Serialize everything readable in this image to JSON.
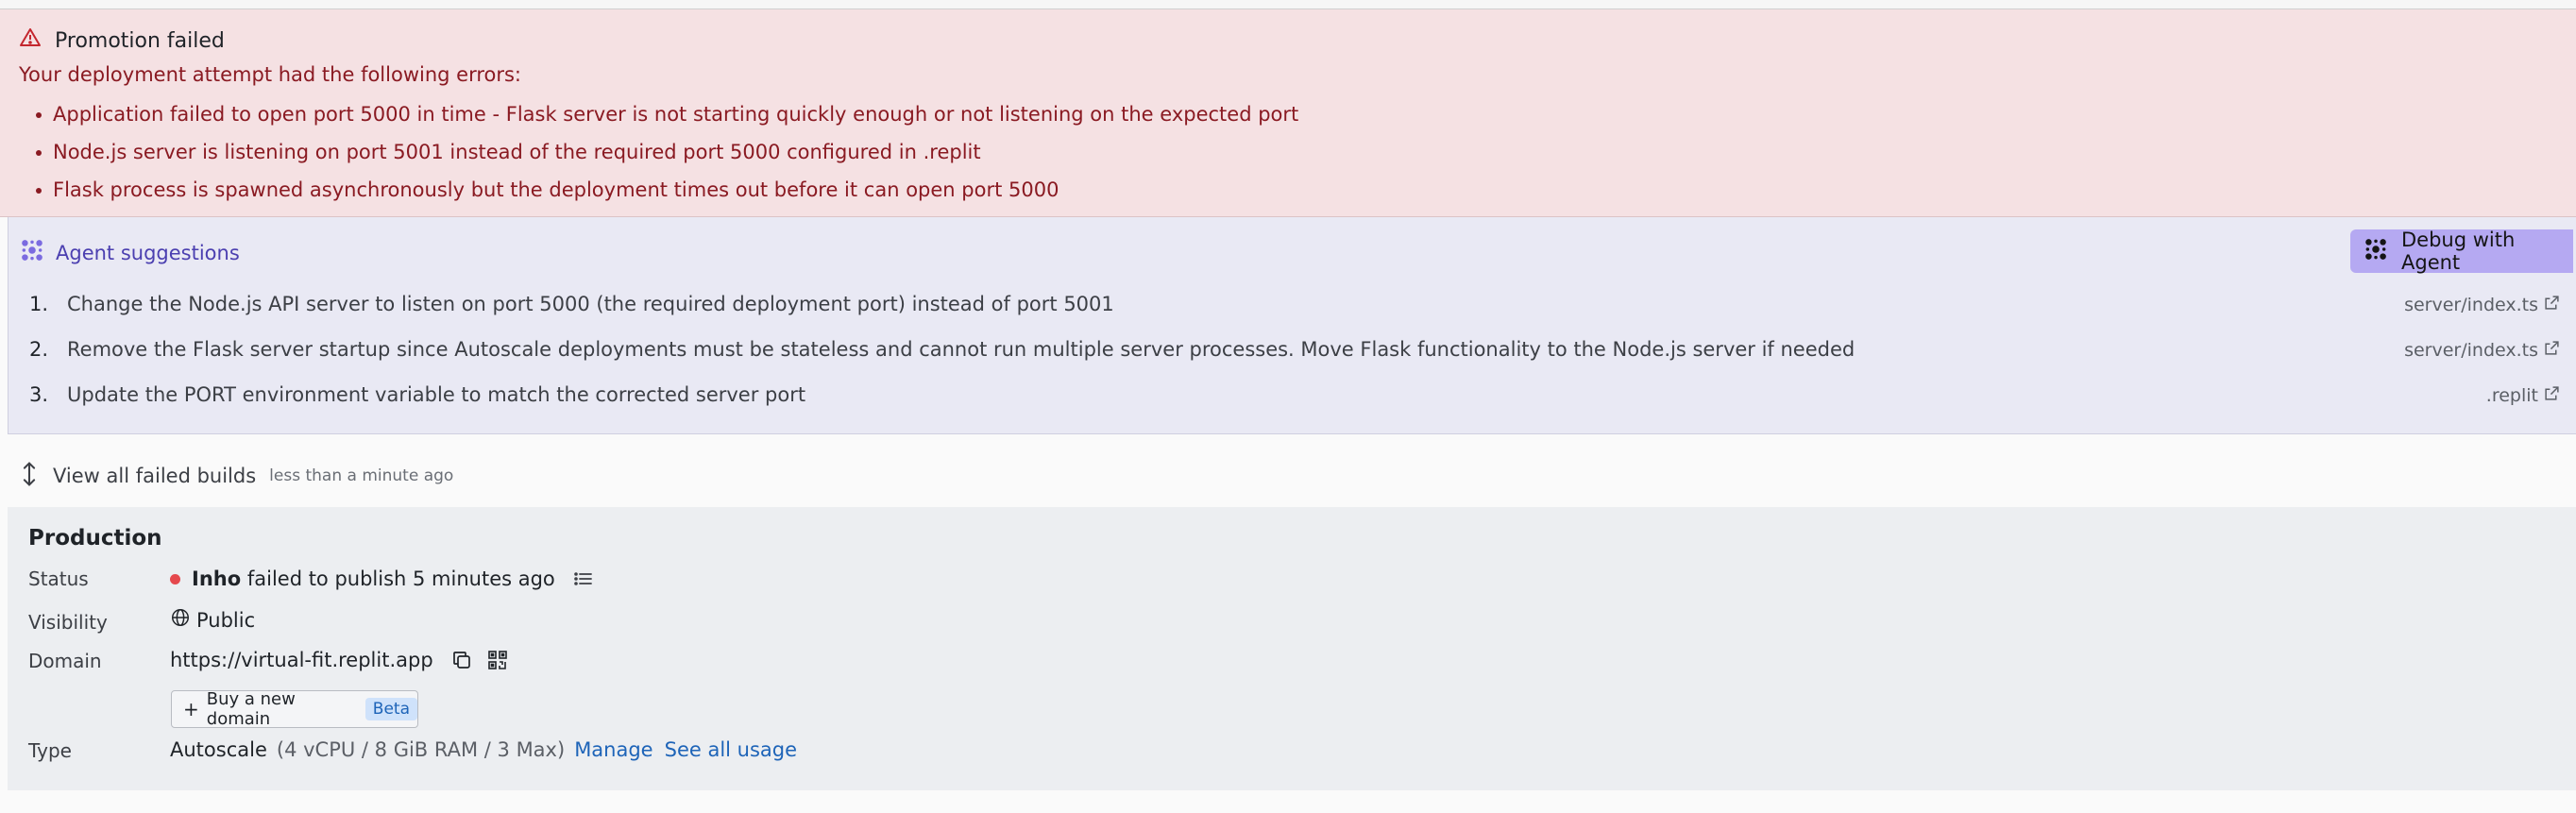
{
  "error": {
    "title": "Promotion failed",
    "intro": "Your deployment attempt had the following errors:",
    "items": [
      "Application failed to open port 5000 in time - Flask server is not starting quickly enough or not listening on the expected port",
      "Node.js server is listening on port 5001 instead of the required port 5000 configured in .replit",
      "Flask process is spawned asynchronously but the deployment times out before it can open port 5000"
    ]
  },
  "agent": {
    "title": "Agent suggestions",
    "debug_label": "Debug with Agent",
    "suggestions": [
      {
        "num": "1.",
        "text": "Change the Node.js API server to listen on port 5000 (the required deployment port) instead of port 5001",
        "file": "server/index.ts"
      },
      {
        "num": "2.",
        "text": "Remove the Flask server startup since Autoscale deployments must be stateless and cannot run multiple server processes. Move Flask functionality to the Node.js server if needed",
        "file": "server/index.ts"
      },
      {
        "num": "3.",
        "text": "Update the PORT environment variable to match the corrected server port",
        "file": ".replit"
      }
    ]
  },
  "failed_builds": {
    "label": "View all failed builds",
    "time": "less than a minute ago"
  },
  "production": {
    "title": "Production",
    "status_label": "Status",
    "status_user": "Inho",
    "status_text": "failed to publish 5 minutes ago",
    "visibility_label": "Visibility",
    "visibility_value": "Public",
    "domain_label": "Domain",
    "domain_value": "https://virtual-fit.replit.app",
    "buy_label": "Buy a new domain",
    "beta_label": "Beta",
    "type_label": "Type",
    "type_value": "Autoscale",
    "type_detail": "(4 vCPU / 8 GiB RAM / 3 Max)",
    "manage_label": "Manage",
    "usage_label": "See all usage"
  },
  "colors": {
    "error_bg": "#f5e1e3",
    "error_text": "#8a1a22",
    "agent_bg": "#e9e9f4",
    "agent_accent": "#4b3fb0",
    "debug_btn": "#b5a9f2",
    "link": "#1e64b8",
    "status_dot": "#e5484d"
  }
}
